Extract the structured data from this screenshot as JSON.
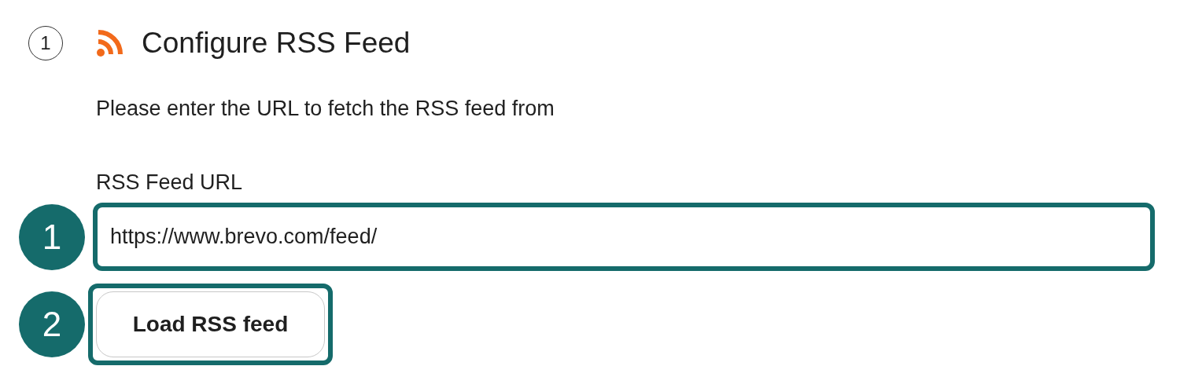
{
  "step": {
    "number": "1",
    "title": "Configure RSS Feed"
  },
  "description": "Please enter the URL to fetch the RSS feed from",
  "field": {
    "label": "RSS Feed URL",
    "value": "https://www.brevo.com/feed/"
  },
  "button": {
    "label": "Load RSS feed"
  },
  "callouts": [
    "1",
    "2"
  ]
}
